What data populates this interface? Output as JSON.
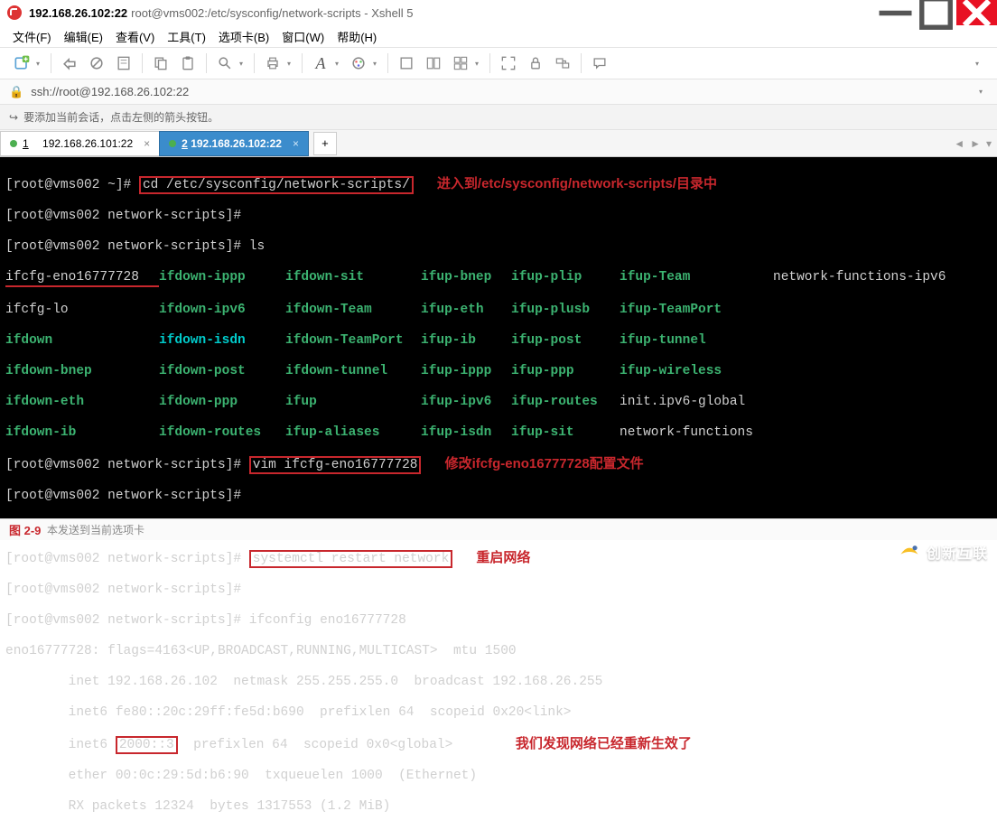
{
  "titlebar": {
    "title": "192.168.26.102:22",
    "subtitle": " root@vms002:/etc/sysconfig/network-scripts - Xshell 5"
  },
  "menubar": {
    "items": [
      "文件(F)",
      "编辑(E)",
      "查看(V)",
      "工具(T)",
      "选项卡(B)",
      "窗口(W)",
      "帮助(H)"
    ]
  },
  "addrbar": {
    "url": "ssh://root@192.168.26.102:22"
  },
  "hintbar": {
    "text": "要添加当前会话，点击左侧的箭头按钮。"
  },
  "tabs": {
    "items": [
      {
        "num": "1",
        "label": "192.168.26.101:22",
        "active": false
      },
      {
        "num": "2",
        "label": "192.168.26.102:22",
        "active": true
      }
    ]
  },
  "terminal": {
    "prompt_home": "[root@vms002 ~]#",
    "prompt_ns": "[root@vms002 network-scripts]#",
    "cmd_cd": "cd /etc/sysconfig/network-scripts/",
    "anno_cd": "进入到/etc/sysconfig/network-scripts/目录中",
    "cmd_ls": "ls",
    "ls_cols": [
      [
        "ifcfg-eno16777728",
        "ifcfg-lo",
        "ifdown",
        "ifdown-bnep",
        "ifdown-eth",
        "ifdown-ib"
      ],
      [
        "ifdown-ippp",
        "ifdown-ipv6",
        "ifdown-isdn",
        "ifdown-post",
        "ifdown-ppp",
        "ifdown-routes"
      ],
      [
        "ifdown-sit",
        "ifdown-Team",
        "ifdown-TeamPort",
        "ifdown-tunnel",
        "ifup",
        "ifup-aliases"
      ],
      [
        "ifup-bnep",
        "ifup-eth",
        "ifup-ib",
        "ifup-ippp",
        "ifup-ipv6",
        "ifup-isdn"
      ],
      [
        "ifup-plip",
        "ifup-plusb",
        "ifup-post",
        "ifup-ppp",
        "ifup-routes",
        "ifup-sit"
      ],
      [
        "ifup-Team",
        "ifup-TeamPort",
        "ifup-tunnel",
        "ifup-wireless",
        "init.ipv6-global",
        "network-functions"
      ],
      [
        "network-functions-ipv6",
        "",
        "",
        "",
        "",
        ""
      ]
    ],
    "cmd_vim": "vim ifcfg-eno16777728",
    "anno_vim": "修改ifcfg-eno16777728配置文件",
    "cmd_restart": "systemctl restart network",
    "anno_restart": "重启网络",
    "cmd_ifconfig": "ifconfig eno16777728",
    "ifconfig_out": [
      "eno16777728: flags=4163<UP,BROADCAST,RUNNING,MULTICAST>  mtu 1500",
      "        inet 192.168.26.102  netmask 255.255.255.0  broadcast 192.168.26.255",
      "        inet6 fe80::20c:29ff:fe5d:b690  prefixlen 64  scopeid 0x20<link>",
      "        inet6 2000::3  prefixlen 64  scopeid 0x0<global>",
      "        ether 00:0c:29:5d:b6:90  txqueuelen 1000  (Ethernet)",
      "        RX packets 12324  bytes 1317553 (1.2 MiB)"
    ],
    "ipv6_val": "2000::3",
    "anno_net": "我们发现网络已经重新生效了"
  },
  "statusbar": {
    "figlabel": "图 2-9",
    "text": "本发送到当前选项卡"
  },
  "watermark": {
    "text": "创新互联"
  }
}
